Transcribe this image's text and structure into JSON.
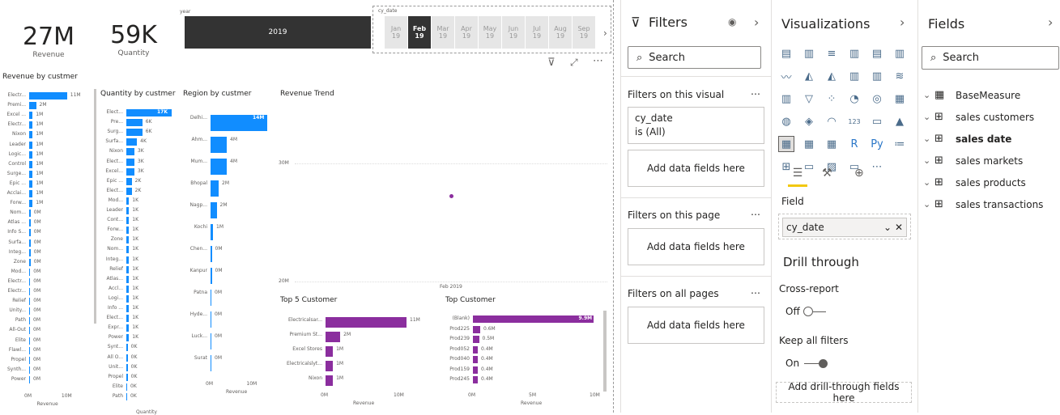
{
  "kpis": [
    {
      "value": "27M",
      "label": "Revenue"
    },
    {
      "value": "59K",
      "label": "Quantity"
    }
  ],
  "year_slicer": {
    "header": "year",
    "selected": "2019"
  },
  "month_slicer": {
    "header": "cy_date",
    "months": [
      {
        "m": "Jan",
        "y": "19"
      },
      {
        "m": "Feb",
        "y": "19"
      },
      {
        "m": "Mar",
        "y": "19"
      },
      {
        "m": "Apr",
        "y": "19"
      },
      {
        "m": "May",
        "y": "19"
      },
      {
        "m": "Jun",
        "y": "19"
      },
      {
        "m": "Jul",
        "y": "19"
      },
      {
        "m": "Aug",
        "y": "19"
      },
      {
        "m": "Sep",
        "y": "19"
      }
    ],
    "selected_index": 1
  },
  "charts": {
    "rev_customer": {
      "title": "Revenue by custmer",
      "axis_label": "Revenue",
      "ticks": [
        "0M",
        "10M"
      ],
      "max": 12,
      "labels": [
        "Electr...",
        "Premi...",
        "Excel ...",
        "Electr...",
        "Nixon",
        "Leader",
        "Logic...",
        "Control",
        "Surge...",
        "Epic ...",
        "Acclai...",
        "Forw...",
        "Nom...",
        "Atlas ...",
        "Info S...",
        "Surfa...",
        "Integ...",
        "Zone",
        "Mod...",
        "Electr...",
        "Electr...",
        "Relief",
        "Unity...",
        "Path",
        "All-Out",
        "Elite",
        "Flawl...",
        "Propel",
        "Synth...",
        "Power"
      ],
      "values": [
        11,
        2,
        1,
        1,
        1,
        1,
        1,
        1,
        1,
        1,
        1,
        1,
        0.4,
        0.4,
        0.4,
        0.4,
        0.4,
        0.4,
        0.3,
        0.3,
        0.3,
        0.3,
        0.3,
        0.2,
        0.2,
        0.2,
        0.2,
        0.2,
        0.2,
        0.2
      ],
      "value_labels": [
        "11M",
        "2M",
        "1M",
        "1M",
        "1M",
        "1M",
        "1M",
        "1M",
        "1M",
        "1M",
        "1M",
        "1M",
        "0M",
        "0M",
        "0M",
        "0M",
        "0M",
        "0M",
        "0M",
        "0M",
        "0M",
        "0M",
        "0M",
        "0M",
        "0M",
        "0M",
        "0M",
        "0M",
        "0M",
        "0M"
      ]
    },
    "qty_customer": {
      "title": "Quantity by custmer",
      "axis_label": "Quantity",
      "max": 17,
      "labels": [
        "Elect...",
        "Pre...",
        "Surg...",
        "Surfa...",
        "Nixon",
        "Elect...",
        "Excel...",
        "Epic ...",
        "Elect...",
        "Mod...",
        "Leader",
        "Cont...",
        "Forw...",
        "Zone",
        "Nom...",
        "Integ...",
        "Relief",
        "Atlas...",
        "Accl...",
        "Logi...",
        "Info ...",
        "Elect...",
        "Expr...",
        "Power",
        "Synt...",
        "All O...",
        "Unit...",
        "Propel",
        "Elite",
        "Path"
      ],
      "values": [
        17,
        6,
        6,
        4,
        3,
        3,
        3,
        2,
        2,
        1,
        1,
        1,
        1,
        1,
        1,
        1,
        1,
        1,
        1,
        1,
        1,
        1,
        1,
        1,
        0.5,
        0.5,
        0.5,
        0.5,
        0.3,
        0.3
      ],
      "value_labels": [
        "17K",
        "6K",
        "6K",
        "4K",
        "3K",
        "3K",
        "3K",
        "2K",
        "2K",
        "1K",
        "1K",
        "1K",
        "1K",
        "1K",
        "1K",
        "1K",
        "1K",
        "1K",
        "1K",
        "1K",
        "1K",
        "1K",
        "1K",
        "1K",
        "0K",
        "0K",
        "0K",
        "0K",
        "0K",
        "0K"
      ]
    },
    "region_customer": {
      "title": "Region by custmer",
      "axis_label": "Revenue",
      "ticks": [
        "0M",
        "10M"
      ],
      "max": 14,
      "labels": [
        "Delhi...",
        "Ahm...",
        "Mum...",
        "Bhopal",
        "Nagp...",
        "Kochi",
        "Chen...",
        "Kanpur",
        "Patna",
        "Hyde...",
        "Luck...",
        "Surat"
      ],
      "values": [
        14,
        4,
        4,
        2,
        1.5,
        0.6,
        0.3,
        0.3,
        0.2,
        0.2,
        0.2,
        0.2
      ],
      "value_labels": [
        "14M",
        "4M",
        "4M",
        "2M",
        "2M",
        "1M",
        "0M",
        "0M",
        "0M",
        "0M",
        "0M",
        "0M"
      ]
    },
    "revenue_trend": {
      "title": "Revenue Trend",
      "y_ticks": [
        "30M",
        "20M"
      ],
      "x_label": "Feb 2019"
    },
    "top5": {
      "title": "Top 5 Customer",
      "axis_label": "Revenue",
      "ticks": [
        "0M",
        "10M"
      ],
      "max": 11,
      "labels": [
        "Electricalsar...",
        "Premium St...",
        "Excel Stores",
        "Electricalslyt...",
        "Nixon"
      ],
      "values": [
        11,
        2,
        1,
        1,
        1
      ],
      "value_labels": [
        "11M",
        "2M",
        "1M",
        "1M",
        "1M"
      ]
    },
    "top_customer": {
      "title": "Top Customer",
      "axis_label": "Revenue",
      "ticks": [
        "0M",
        "5M",
        "10M"
      ],
      "max": 10,
      "labels": [
        "(Blank)",
        "Prod225",
        "Prod239",
        "Prod052",
        "Prod040",
        "Prod159",
        "Prod245"
      ],
      "values": [
        9.9,
        0.6,
        0.5,
        0.4,
        0.4,
        0.4,
        0.4
      ],
      "value_labels": [
        "9.9M",
        "0.6M",
        "0.5M",
        "0.4M",
        "0.4M",
        "0.4M",
        "0.4M"
      ]
    }
  },
  "filters": {
    "title": "Filters",
    "search_placeholder": "Search",
    "visual_section": "Filters on this visual",
    "card_name": "cy_date",
    "card_value": "is (All)",
    "add_fields": "Add data fields here",
    "page_section": "Filters on this page",
    "all_section": "Filters on all pages",
    "more": "…"
  },
  "visualizations": {
    "title": "Visualizations",
    "field_label": "Field",
    "field_value": "cy_date",
    "drill_title": "Drill through",
    "cross_report": "Cross-report",
    "cross_state": "Off",
    "keep_filters": "Keep all filters",
    "keep_state": "On",
    "add_drill": "Add drill-through fields here",
    "more": "…"
  },
  "fields": {
    "title": "Fields",
    "search_placeholder": "Search",
    "tables": [
      "BaseMeasure",
      "sales customers",
      "sales date",
      "sales markets",
      "sales products",
      "sales transactions"
    ],
    "bold_index": 2
  },
  "colors": {
    "blue": "#118dff",
    "purple": "#8b2e9e",
    "accent": "#f2c811"
  }
}
